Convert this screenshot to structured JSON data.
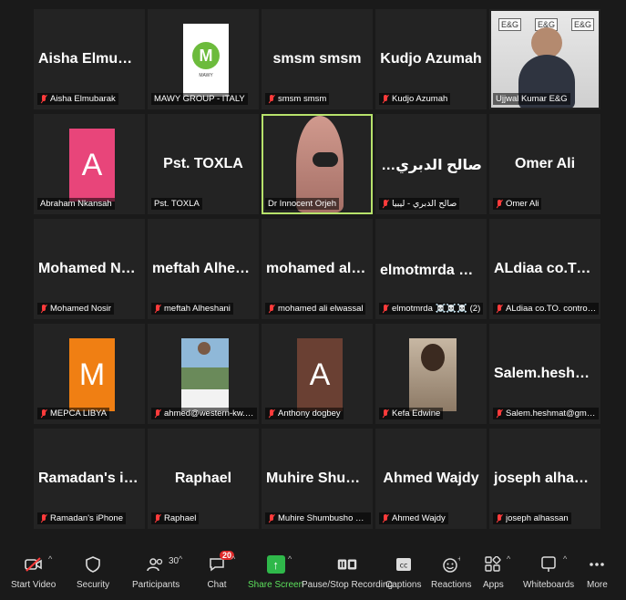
{
  "participants": [
    {
      "big": "Aisha Elmubarak",
      "name": "Aisha Elmubarak"
    },
    {
      "big": "",
      "name": "MAWY GROUP - ITALY",
      "logo_text": "M",
      "logo_sub": "MAWY"
    },
    {
      "big": "smsm smsm",
      "name": "smsm smsm"
    },
    {
      "big": "Kudjo Azumah",
      "name": "Kudjo Azumah"
    },
    {
      "big": "",
      "name": "Ujjwal Kumar E&G",
      "logo_tag": "E&G"
    },
    {
      "big": "",
      "name": "Abraham Nkansah",
      "letter": "A",
      "color": "#e8457a"
    },
    {
      "big": "Pst. TOXLA",
      "name": "Pst. TOXLA"
    },
    {
      "big": "",
      "name": "Dr Innocent Orjeh"
    },
    {
      "big": "صالح الدبري - ليبيا",
      "name": "صالح الدبري - ليبيا"
    },
    {
      "big": "Omer Ali",
      "name": "Omer Ali"
    },
    {
      "big": "Mohamed Nosir",
      "name": "Mohamed Nosir"
    },
    {
      "big": "meftah Alheshani",
      "name": "meftah Alheshani"
    },
    {
      "big": "mohamed ali el...",
      "name": "mohamed ali elwassal"
    },
    {
      "big": "elmotmrda ☠️�",
      "name": "elmotmrda ☠️☠️☠️ (2)"
    },
    {
      "big": "ALdiaa co.TO. c...",
      "name": "ALdiaa co.TO. control types ..."
    },
    {
      "big": "",
      "name": "MEPCA LIBYA",
      "letter": "M",
      "color": "#f07f13"
    },
    {
      "big": "",
      "name": "ahmed@western-kw.com"
    },
    {
      "big": "",
      "name": "Anthony dogbey",
      "letter": "A",
      "color": "#6a4033"
    },
    {
      "big": "",
      "name": "Kefa Edwine"
    },
    {
      "big": "Salem.heshmat...",
      "name": "Salem.heshmat@gmail.com"
    },
    {
      "big": "Ramadan's iPho...",
      "name": "Ramadan's iPhone"
    },
    {
      "big": "Raphael",
      "name": "Raphael"
    },
    {
      "big": "Muhire Shumb...",
      "name": "Muhire Shumbusho Christian"
    },
    {
      "big": "Ahmed Wajdy",
      "name": "Ahmed Wajdy"
    },
    {
      "big": "joseph alhassan",
      "name": "joseph alhassan"
    }
  ],
  "toolbar": {
    "start_video": "Start Video",
    "security": "Security",
    "participants": "Participants",
    "participants_count": "30",
    "chat": "Chat",
    "chat_badge": "20",
    "share_screen": "Share Screen",
    "pause_recording": "Pause/Stop Recording",
    "captions": "Captions",
    "reactions": "Reactions",
    "apps": "Apps",
    "whiteboards": "Whiteboards",
    "more": "More"
  },
  "colors": {
    "active_speaker_border": "#b7e26b",
    "share_green": "#2fb84a",
    "muted_red": "#ff3b3b",
    "badge_red": "#e02828"
  },
  "icons": {
    "muted": "mic-off-icon",
    "video_off": "video-off-icon",
    "security": "shield-icon",
    "participants": "people-icon",
    "chat": "chat-bubble-icon",
    "share": "share-arrow-icon",
    "recording": "pause-stop-icon",
    "captions": "cc-icon",
    "reactions": "emoji-icon",
    "apps": "apps-icon",
    "whiteboards": "whiteboard-icon",
    "more": "more-dots-icon"
  }
}
